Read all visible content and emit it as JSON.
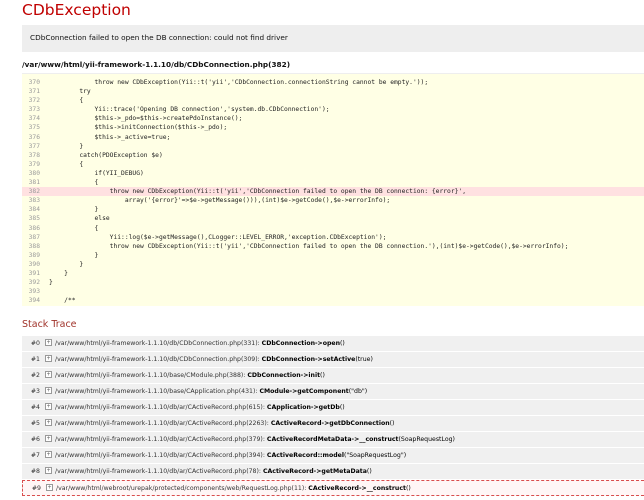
{
  "exception": {
    "title": "CDbException",
    "message": "CDbConnection failed to open the DB connection: could not find driver",
    "source_file": "/var/www/html/yii-framework-1.1.10/db/CDbConnection.php(382)"
  },
  "source": {
    "error_line": 382,
    "lines": [
      {
        "n": "370",
        "code": "            throw new CDbException(Yii::t('yii','CDbConnection.connectionString cannot be empty.'));"
      },
      {
        "n": "371",
        "code": "        try"
      },
      {
        "n": "372",
        "code": "        {"
      },
      {
        "n": "373",
        "code": "            Yii::trace('Opening DB connection','system.db.CDbConnection');"
      },
      {
        "n": "374",
        "code": "            $this->_pdo=$this->createPdoInstance();"
      },
      {
        "n": "375",
        "code": "            $this->initConnection($this->_pdo);"
      },
      {
        "n": "376",
        "code": "            $this->_active=true;"
      },
      {
        "n": "377",
        "code": "        }"
      },
      {
        "n": "378",
        "code": "        catch(PDOException $e)"
      },
      {
        "n": "379",
        "code": "        {"
      },
      {
        "n": "380",
        "code": "            if(YII_DEBUG)"
      },
      {
        "n": "381",
        "code": "            {"
      },
      {
        "n": "382",
        "code": "                throw new CDbException(Yii::t('yii','CDbConnection failed to open the DB connection: {error}',"
      },
      {
        "n": "383",
        "code": "                    array('{error}'=>$e->getMessage())),(int)$e->getCode(),$e->errorInfo);"
      },
      {
        "n": "384",
        "code": "            }"
      },
      {
        "n": "385",
        "code": "            else"
      },
      {
        "n": "386",
        "code": "            {"
      },
      {
        "n": "387",
        "code": "                Yii::log($e->getMessage(),CLogger::LEVEL_ERROR,'exception.CDbException');"
      },
      {
        "n": "388",
        "code": "                throw new CDbException(Yii::t('yii','CDbConnection failed to open the DB connection.'),(int)$e->getCode(),$e->errorInfo);"
      },
      {
        "n": "389",
        "code": "            }"
      },
      {
        "n": "390",
        "code": "        }"
      },
      {
        "n": "391",
        "code": "    }"
      },
      {
        "n": "392",
        "code": "}"
      },
      {
        "n": "393",
        "code": ""
      },
      {
        "n": "394",
        "code": "    /**"
      }
    ]
  },
  "stack_trace": {
    "title": "Stack Trace",
    "expand_symbol": "+",
    "rows": [
      {
        "index": "#0",
        "file": "/var/www/html/yii-framework-1.1.10/db/CDbConnection.php(331): ",
        "cls": "CDbConnection",
        "arrow": "->",
        "method": "open",
        "args": "()",
        "app": false
      },
      {
        "index": "#1",
        "file": "/var/www/html/yii-framework-1.1.10/db/CDbConnection.php(309): ",
        "cls": "CDbConnection",
        "arrow": "->",
        "method": "setActive",
        "args": "(true)",
        "app": false
      },
      {
        "index": "#2",
        "file": "/var/www/html/yii-framework-1.1.10/base/CModule.php(388): ",
        "cls": "CDbConnection",
        "arrow": "->",
        "method": "init",
        "args": "()",
        "app": false
      },
      {
        "index": "#3",
        "file": "/var/www/html/yii-framework-1.1.10/base/CApplication.php(431): ",
        "cls": "CModule",
        "arrow": "->",
        "method": "getComponent",
        "args": "(\"db\")",
        "app": false
      },
      {
        "index": "#4",
        "file": "/var/www/html/yii-framework-1.1.10/db/ar/CActiveRecord.php(615): ",
        "cls": "CApplication",
        "arrow": "->",
        "method": "getDb",
        "args": "()",
        "app": false
      },
      {
        "index": "#5",
        "file": "/var/www/html/yii-framework-1.1.10/db/ar/CActiveRecord.php(2263): ",
        "cls": "CActiveRecord",
        "arrow": "->",
        "method": "getDbConnection",
        "args": "()",
        "app": false
      },
      {
        "index": "#6",
        "file": "/var/www/html/yii-framework-1.1.10/db/ar/CActiveRecord.php(379): ",
        "cls": "CActiveRecordMetaData",
        "arrow": "->",
        "method": "__construct",
        "args": "(SoapRequestLog)",
        "app": false
      },
      {
        "index": "#7",
        "file": "/var/www/html/yii-framework-1.1.10/db/ar/CActiveRecord.php(394): ",
        "cls": "CActiveRecord",
        "arrow": "::",
        "method": "model",
        "args": "(\"SoapRequestLog\")",
        "app": false
      },
      {
        "index": "#8",
        "file": "/var/www/html/yii-framework-1.1.10/db/ar/CActiveRecord.php(78): ",
        "cls": "CActiveRecord",
        "arrow": "->",
        "method": "getMetaData",
        "args": "()",
        "app": false
      },
      {
        "index": "#9",
        "file": "/var/www/html/webroot/urepak/protected/components/web/RequestLog.php(11): ",
        "cls": "CActiveRecord",
        "arrow": "->",
        "method": "__construct",
        "args": "()",
        "app": true
      }
    ]
  },
  "colors": {
    "title_red": "#c00000",
    "message_bg": "#eeeeee",
    "code_bg": "#ffffe5",
    "error_line_bg": "#ffe1e1",
    "stack_title": "#a0332a",
    "trace_row_bg": "#f0f0f0",
    "app_row_border": "#d94d4d"
  }
}
